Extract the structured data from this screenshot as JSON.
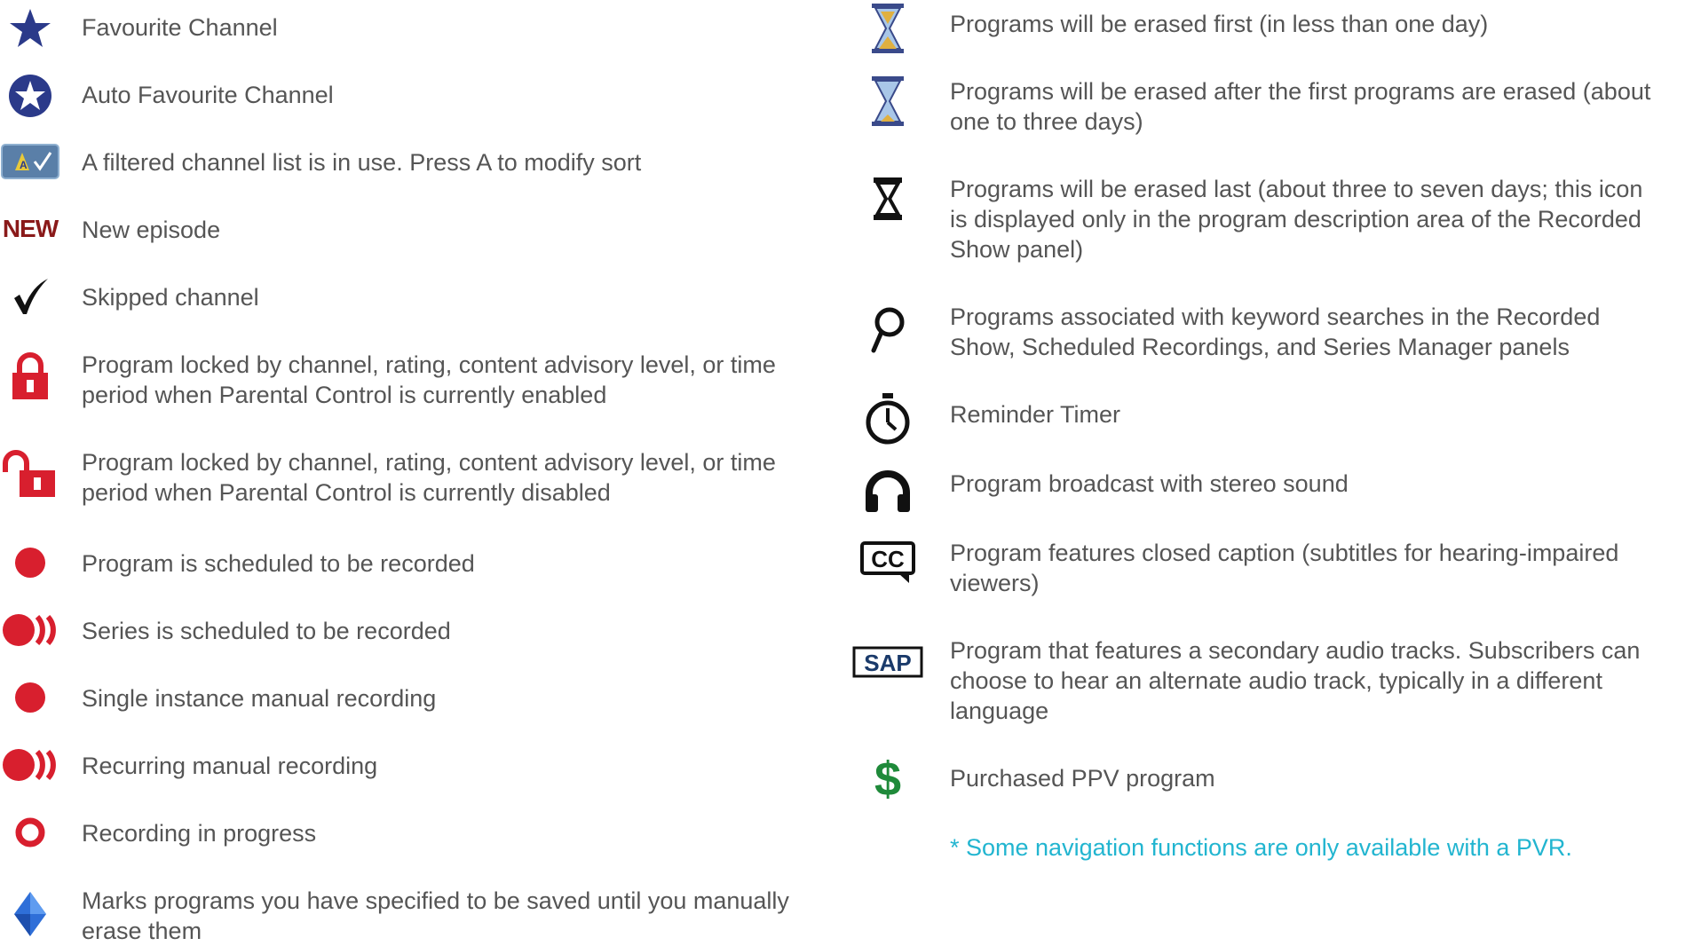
{
  "colors": {
    "text": "#555555",
    "note": "#22b5d0",
    "record_red": "#d81f2e",
    "star_blue": "#2b3a8a",
    "dollar_green": "#1f8a3a"
  },
  "left_items": [
    {
      "icon": "star-icon",
      "label": "Favourite Channel"
    },
    {
      "icon": "auto-favourite-star-icon",
      "label": "Auto Favourite Channel"
    },
    {
      "icon": "filter-list-icon",
      "label": "A filtered channel list is in use. Press A to modify sort"
    },
    {
      "icon": "new-episode-icon",
      "label": "New episode",
      "icon_text": "NEW"
    },
    {
      "icon": "checkmark-icon",
      "label": "Skipped channel"
    },
    {
      "icon": "lock-closed-icon",
      "label": "Program locked by channel, rating, content advisory level, or time period when Parental Control is currently enabled"
    },
    {
      "icon": "lock-open-icon",
      "label": "Program locked by channel, rating, content advisory level, or time period when Parental Control is currently disabled"
    },
    {
      "icon": "record-dot-icon",
      "label": "Program is scheduled to be recorded"
    },
    {
      "icon": "series-record-icon",
      "label": "Series is scheduled to be recorded"
    },
    {
      "icon": "record-dot-icon",
      "label": "Single instance manual recording"
    },
    {
      "icon": "series-record-icon",
      "label": "Recurring manual recording"
    },
    {
      "icon": "recording-ring-icon",
      "label": "Recording in progress"
    },
    {
      "icon": "diamond-icon",
      "label": "Marks programs you have specified to be saved until you manually erase them"
    }
  ],
  "right_items": [
    {
      "icon": "hourglass-full-icon",
      "label": "Programs will be erased first (in less than one day)"
    },
    {
      "icon": "hourglass-half-icon",
      "label": "Programs will be erased after the first programs are erased (about one to three days)"
    },
    {
      "icon": "hourglass-empty-icon",
      "label": "Programs will be erased last (about three to seven days; this icon is displayed only in the program description area of the Recorded Show panel)"
    },
    {
      "icon": "search-icon",
      "label": "Programs associated with keyword searches in the Recorded Show, Scheduled Recordings, and Series Manager panels"
    },
    {
      "icon": "timer-icon",
      "label": "Reminder Timer"
    },
    {
      "icon": "headphones-icon",
      "label": "Program broadcast with stereo sound"
    },
    {
      "icon": "cc-icon",
      "label": "Program features closed caption (subtitles for hearing-impaired viewers)",
      "icon_text": "CC"
    },
    {
      "icon": "sap-icon",
      "label": "Program that features a secondary audio tracks. Subscribers can choose to hear an alternate audio track, typically in a different language",
      "icon_text": "SAP"
    },
    {
      "icon": "dollar-icon",
      "label": "Purchased PPV program",
      "icon_text": "$"
    }
  ],
  "footnote": "* Some navigation functions are only available with a PVR."
}
